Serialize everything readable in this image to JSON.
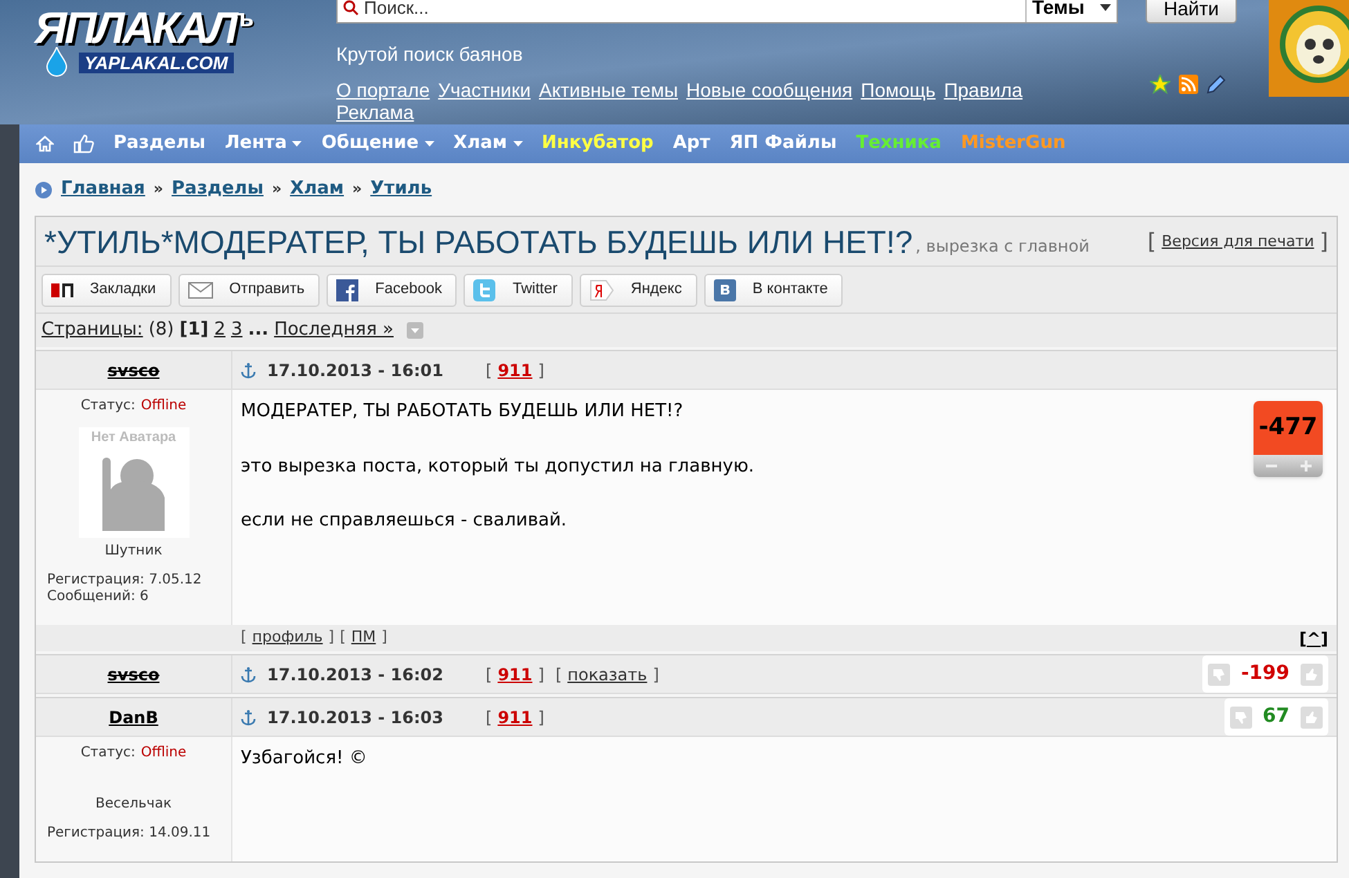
{
  "header": {
    "logo": {
      "text": "ЯПЛАКАЛ",
      "mark": "ъ",
      "domain": "YAPLAKAL.COM"
    },
    "search": {
      "placeholder": "Поиск...",
      "scope": "Темы",
      "button": "Найти"
    },
    "tagline": "Крутой поиск баянов",
    "links": [
      "О портале",
      "Участники",
      "Активные темы",
      "Новые сообщения",
      "Помощь",
      "Правила",
      "Реклама"
    ]
  },
  "nav": [
    {
      "kind": "home"
    },
    {
      "kind": "like"
    },
    {
      "kind": "link",
      "label": "Разделы",
      "dropdown": false,
      "color": "#ffffff"
    },
    {
      "kind": "link",
      "label": "Лента",
      "dropdown": true,
      "color": "#ffffff"
    },
    {
      "kind": "link",
      "label": "Общение",
      "dropdown": true,
      "color": "#ffffff"
    },
    {
      "kind": "link",
      "label": "Хлам",
      "dropdown": true,
      "color": "#ffffff"
    },
    {
      "kind": "link",
      "label": "Инкубатор",
      "dropdown": false,
      "color": "#ffff44"
    },
    {
      "kind": "link",
      "label": "Арт",
      "dropdown": false,
      "color": "#ffffff"
    },
    {
      "kind": "link",
      "label": "ЯП Файлы",
      "dropdown": false,
      "color": "#ffffff"
    },
    {
      "kind": "link",
      "label": "Техника",
      "dropdown": false,
      "color": "#66ee33"
    },
    {
      "kind": "link",
      "label": "MisterGun",
      "dropdown": false,
      "color": "#ff9922"
    }
  ],
  "brackets": [
    "[",
    "]"
  ],
  "breadcrumb": {
    "separator": "»",
    "items": [
      "Главная",
      "Разделы",
      "Хлам",
      "Утиль"
    ]
  },
  "topic": {
    "title": "*УТИЛЬ*МОДЕРАТЕР, ТЫ РАБОТАТЬ БУДЕШЬ ИЛИ НЕТ!?",
    "subtitle": ", вырезка с главной",
    "print_link": "Версия для печати"
  },
  "share": [
    {
      "kind": "bookmarks",
      "label": "Закладки"
    },
    {
      "kind": "mail",
      "label": "Отправить"
    },
    {
      "kind": "facebook",
      "label": "Facebook"
    },
    {
      "kind": "twitter",
      "label": "Twitter"
    },
    {
      "kind": "yandex",
      "label": "Яндекс"
    },
    {
      "kind": "vk",
      "label": "В контакте"
    }
  ],
  "pagination": {
    "label": "Страницы:",
    "count": "(8)",
    "pages": [
      {
        "label": "1",
        "selected": true
      },
      {
        "label": "2",
        "selected": false
      },
      {
        "label": "3",
        "selected": false
      }
    ],
    "ellipsis": "...",
    "last": "Последняя »"
  },
  "posts": [
    {
      "author": "svsco",
      "banned": true,
      "date": "17.10.2013 - 16:01",
      "number": "911",
      "collapsed": false,
      "rating": {
        "kind": "big",
        "value": "-477",
        "color": "#f24a22"
      },
      "status_label": "Статус:",
      "status": "Offline",
      "avatar": "Нет Аватара",
      "rank": "Шутник",
      "registered": "Регистрация: 7.05.12",
      "messages": "Сообщений: 6",
      "body": [
        "МОДЕРАТЕР, ТЫ РАБОТАТЬ БУДЕШЬ ИЛИ НЕТ!?",
        "это вырезка поста, который ты допустил на главную.",
        "если не справляешься - сваливай."
      ],
      "footer": {
        "links": [
          "профиль",
          "ПМ"
        ],
        "top": "^"
      }
    },
    {
      "author": "svsco",
      "banned": true,
      "date": "17.10.2013 - 16:02",
      "number": "911",
      "collapsed": true,
      "show": "показать",
      "rating": {
        "kind": "small",
        "value": "-199",
        "color": "#d10000"
      }
    },
    {
      "author": "DanB",
      "banned": false,
      "date": "17.10.2013 - 16:03",
      "number": "911",
      "collapsed": false,
      "rating": {
        "kind": "small",
        "value": "67",
        "color": "#228b22"
      },
      "status_label": "Статус:",
      "status": "Offline",
      "rank": "Весельчак",
      "registered": "Регистрация: 14.09.11",
      "body": [
        "Узбагойся! ©"
      ]
    }
  ]
}
